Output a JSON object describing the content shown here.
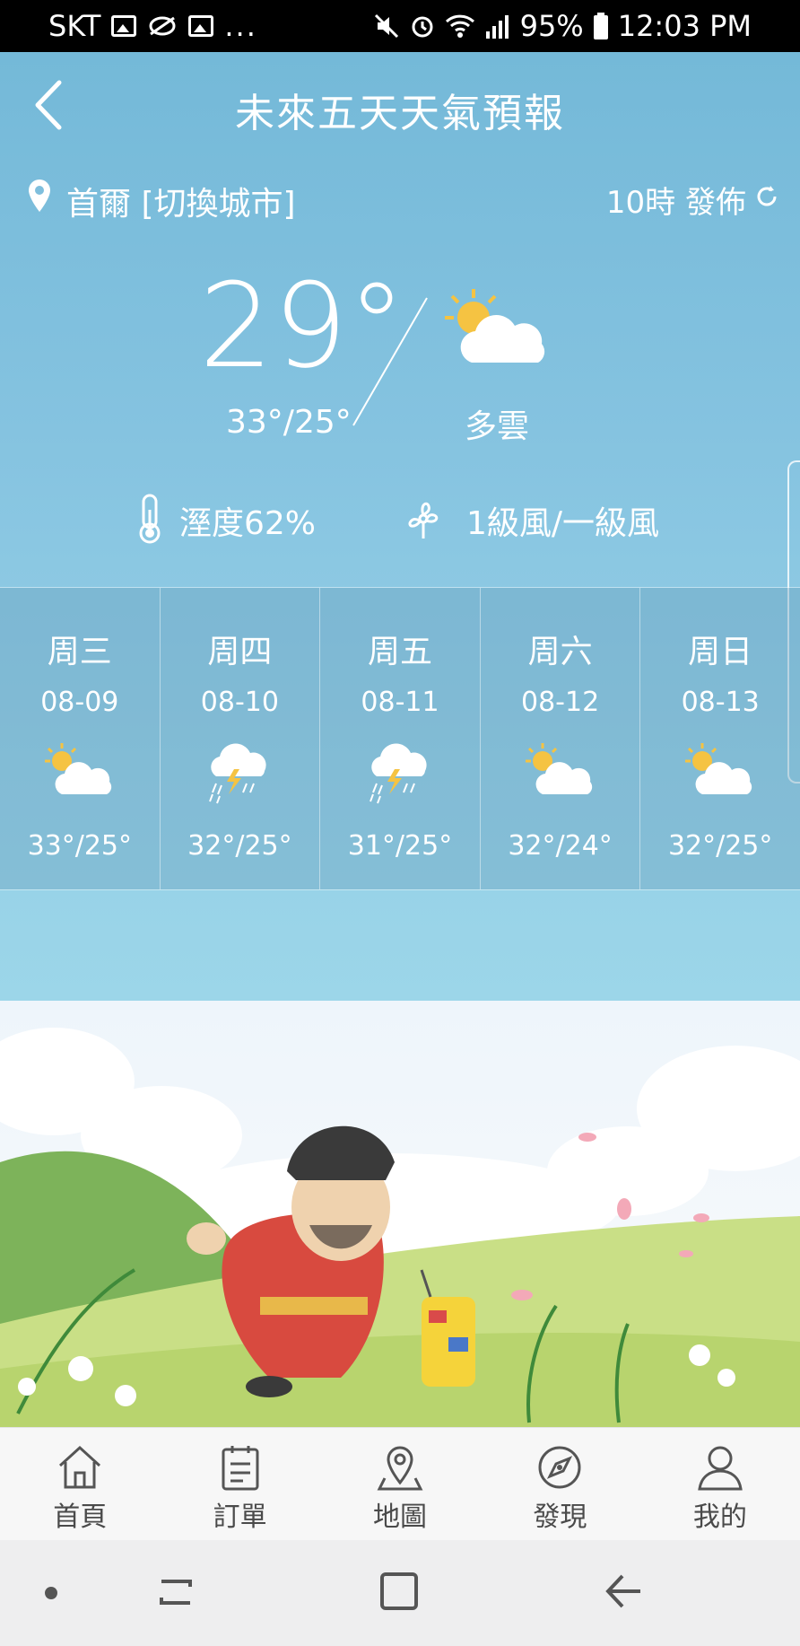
{
  "status_bar": {
    "carrier": "SKT",
    "more": "...",
    "battery": "95%",
    "time": "12:03 PM"
  },
  "header": {
    "title": "未來五天天氣預報"
  },
  "location": {
    "city_label": "首爾 [切換城市]",
    "publish_label": "10時 發佈"
  },
  "current": {
    "temperature": "29°",
    "range": "33°/25°",
    "condition": "多雲",
    "humidity": "溼度62%",
    "wind": "1級風/一級風"
  },
  "forecast": [
    {
      "day": "周三",
      "date": "08-09",
      "icon": "partly-cloudy-icon",
      "range": "33°/25°"
    },
    {
      "day": "周四",
      "date": "08-10",
      "icon": "thunderstorm-icon",
      "range": "32°/25°"
    },
    {
      "day": "周五",
      "date": "08-11",
      "icon": "thunderstorm-icon",
      "range": "31°/25°"
    },
    {
      "day": "周六",
      "date": "08-12",
      "icon": "partly-cloudy-icon",
      "range": "32°/24°"
    },
    {
      "day": "周日",
      "date": "08-13",
      "icon": "partly-cloudy-icon",
      "range": "32°/25°"
    }
  ],
  "tabs": [
    {
      "label": "首頁",
      "icon": "home-icon"
    },
    {
      "label": "訂單",
      "icon": "order-icon"
    },
    {
      "label": "地圖",
      "icon": "map-pin-icon"
    },
    {
      "label": "發現",
      "icon": "compass-icon"
    },
    {
      "label": "我的",
      "icon": "profile-icon"
    }
  ],
  "colors": {
    "sky_top": "#74b9d8",
    "sky_bottom": "#9cd6e9",
    "sun": "#f5c342",
    "tab_text": "#4a4a4a"
  }
}
